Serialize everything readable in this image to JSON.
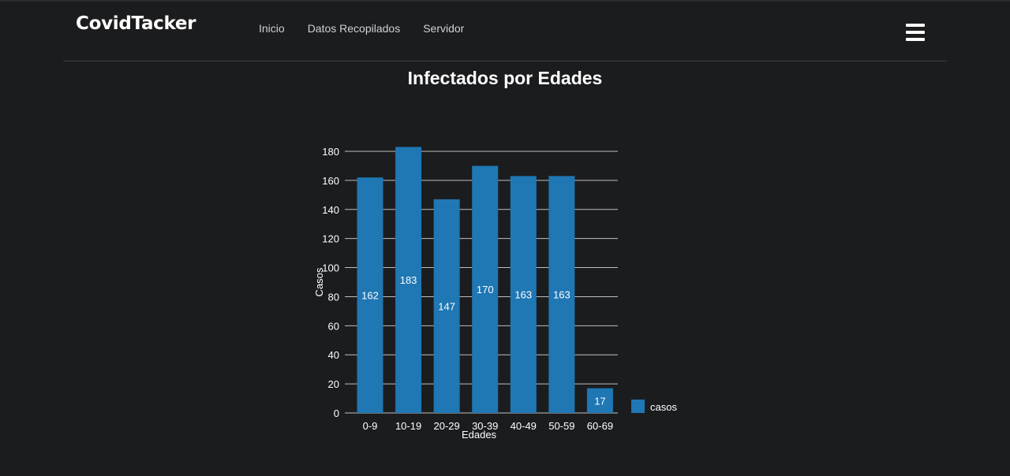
{
  "navbar": {
    "brand": "CovidTacker",
    "links": [
      "Inicio",
      "Datos Recopilados",
      "Servidor"
    ]
  },
  "page": {
    "title": "Infectados por Edades"
  },
  "colors": {
    "bar": "#1f77b4",
    "background": "#1b1c1e",
    "grid": "#bfbfbf",
    "text": "#ffffff"
  },
  "chart_data": {
    "type": "bar",
    "categories": [
      "0-9",
      "10-19",
      "20-29",
      "30-39",
      "40-49",
      "50-59",
      "60-69"
    ],
    "series": [
      {
        "name": "casos",
        "values": [
          162,
          183,
          147,
          170,
          163,
          163,
          17
        ]
      }
    ],
    "xlabel": "Edades",
    "ylabel": "Casos",
    "ylim": [
      0,
      180
    ],
    "yticks": [
      0,
      20,
      40,
      60,
      80,
      100,
      120,
      140,
      160,
      180
    ],
    "grid": true,
    "legend": "bottom-right",
    "data_labels": true
  }
}
